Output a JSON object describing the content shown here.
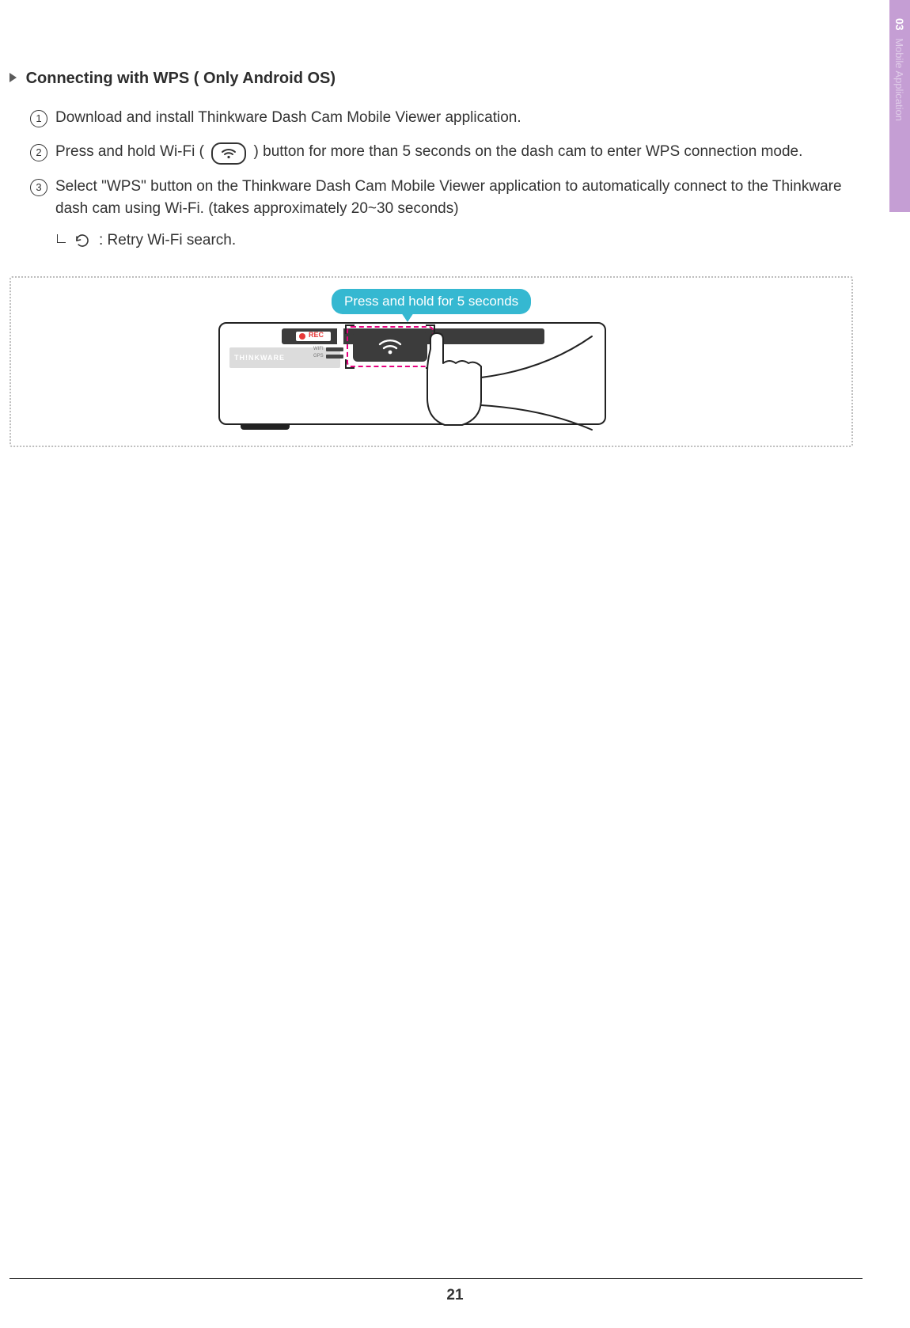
{
  "sidebar": {
    "chapter_num": "03",
    "chapter_title": "Mobile Application"
  },
  "section_title": "Connecting with WPS ( Only Android OS)",
  "steps": [
    {
      "n": "1",
      "text": "Download and install Thinkware Dash Cam Mobile Viewer application."
    },
    {
      "n": "2",
      "before_icon": "Press and hold Wi-Fi (",
      "after_icon": ") button for more than 5 seconds on the dash cam to enter WPS connection mode."
    },
    {
      "n": "3",
      "text": "Select \"WPS\" button on the Thinkware Dash Cam Mobile Viewer application to automatically connect to the Thinkware dash cam using Wi-Fi. (takes approximately 20~30 seconds)"
    }
  ],
  "retry_label": ": Retry Wi-Fi search.",
  "callout": "Press and hold for 5 seconds",
  "device": {
    "brand": "TH!NKWARE",
    "rec": "REC",
    "label1": "WIFI",
    "label2": "GPS"
  },
  "page_number": "21"
}
